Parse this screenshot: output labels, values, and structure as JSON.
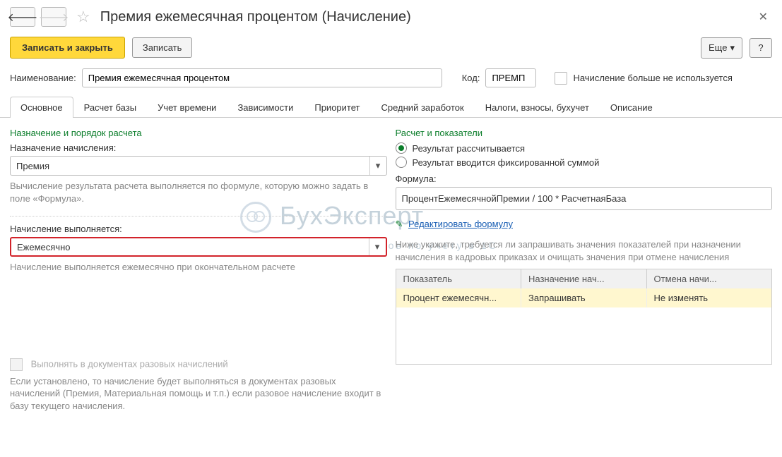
{
  "title": "Премия ежемесячная процентом (Начисление)",
  "toolbar": {
    "write_close": "Записать и закрыть",
    "write": "Записать",
    "more": "Еще",
    "help": "?"
  },
  "fields": {
    "name_label": "Наименование:",
    "name_value": "Премия ежемесячная процентом",
    "code_label": "Код:",
    "code_value": "ПРЕМП",
    "unused_label": "Начисление больше не используется"
  },
  "tabs": [
    "Основное",
    "Расчет базы",
    "Учет времени",
    "Зависимости",
    "Приоритет",
    "Средний заработок",
    "Налоги, взносы, бухучет",
    "Описание"
  ],
  "left": {
    "section1": "Назначение и порядок расчета",
    "purpose_label": "Назначение начисления:",
    "purpose_value": "Премия",
    "purpose_help": "Вычисление результата расчета выполняется по формуле, которую можно задать в поле «Формула».",
    "period_label": "Начисление выполняется:",
    "period_value": "Ежемесячно",
    "period_help": "Начисление выполняется ежемесячно при окончательном расчете",
    "onceoff_label": "Выполнять в документах разовых начислений",
    "onceoff_help": "Если установлено, то начисление будет выполняться в документах разовых начислений (Премия, Материальная помощь и т.п.) если разовое начисление входит в базу текущего начисления."
  },
  "right": {
    "section": "Расчет и показатели",
    "radio_calc": "Результат рассчитывается",
    "radio_fixed": "Результат вводится фиксированной суммой",
    "formula_label": "Формула:",
    "formula_value": "ПроцентЕжемесячнойПремии / 100 * РасчетнаяБаза",
    "edit_link": "Редактировать формулу",
    "note": "Ниже укажите, требуется ли запрашивать значения показателей при назначении начисления в кадровых приказах и очищать значения при отмене начисления",
    "thead": [
      "Показатель",
      "Назначение нач...",
      "Отмена начи..."
    ],
    "trow": [
      "Процент ежемесячн...",
      "Запрашивать",
      "Не изменять"
    ]
  },
  "watermark": {
    "big": "БухЭксперт",
    "sm": "База ответов по учёту в 1С"
  }
}
